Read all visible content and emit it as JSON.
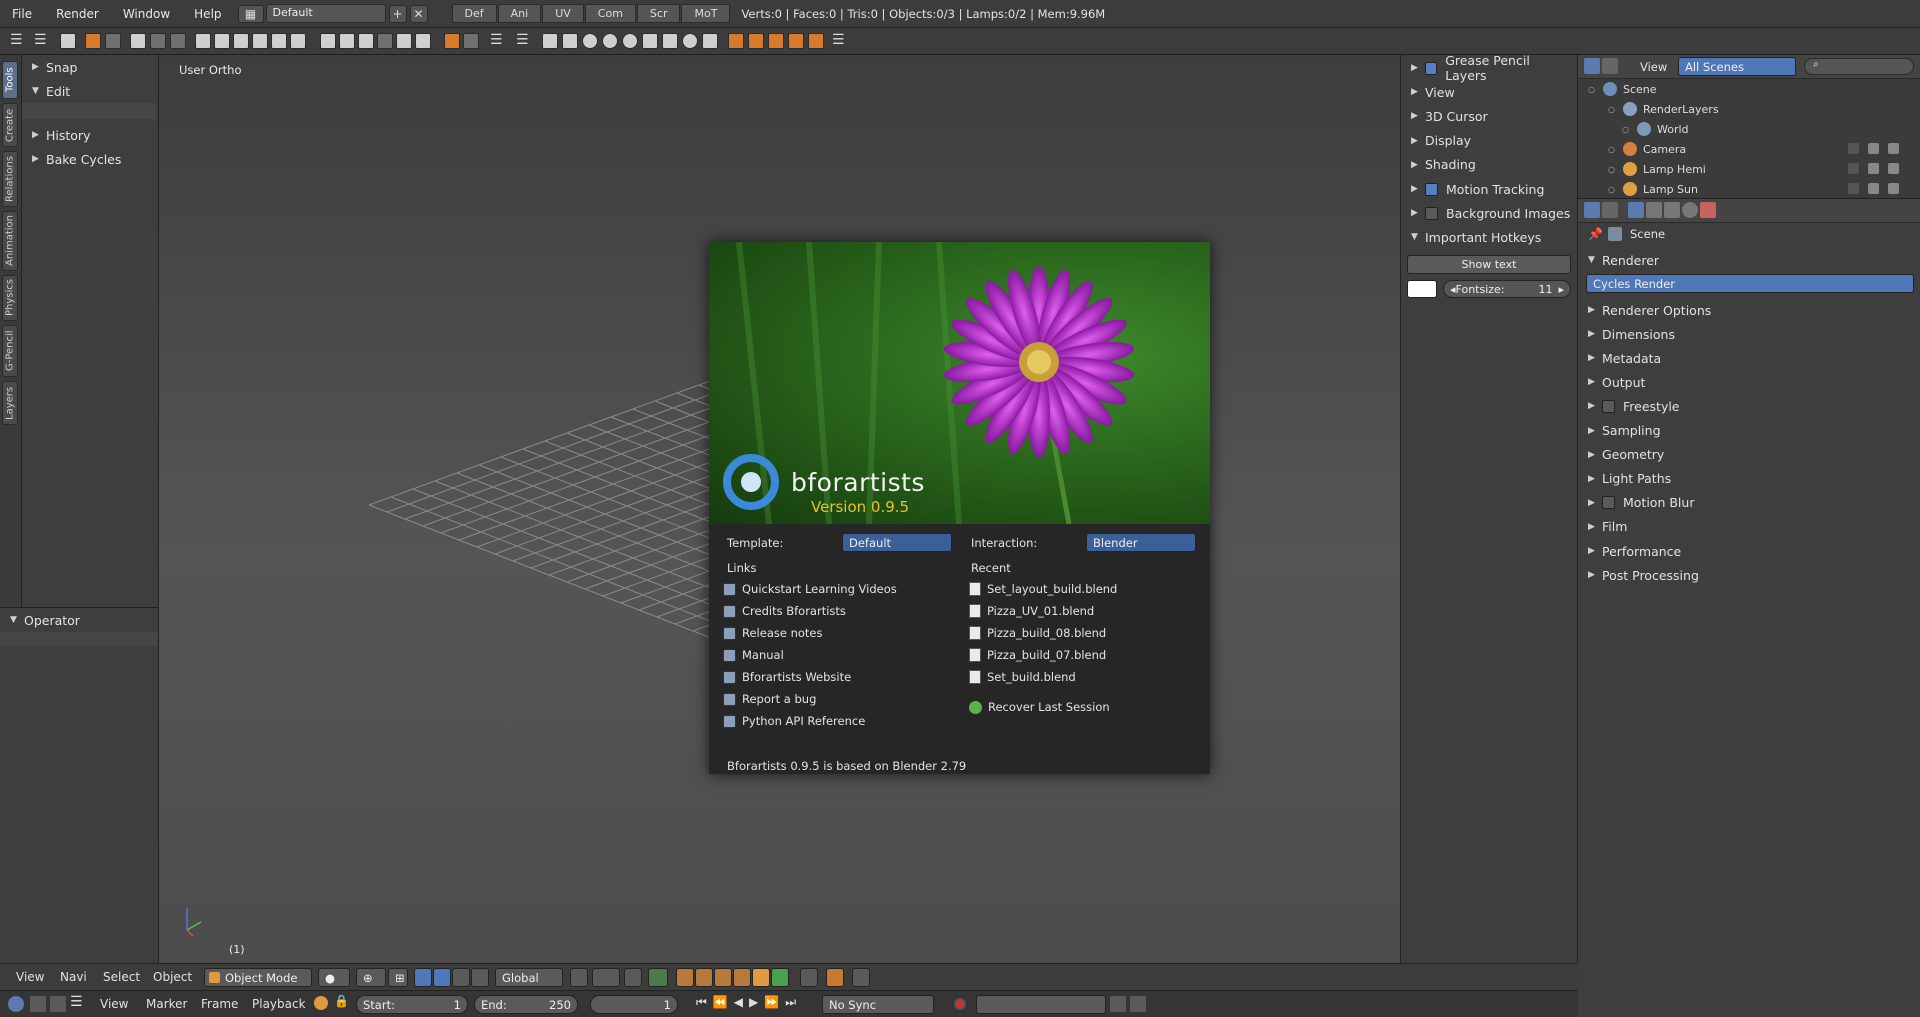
{
  "topbar": {
    "menus": [
      "File",
      "Render",
      "Window",
      "Help"
    ],
    "layout": "Default",
    "workspaces": [
      "Def",
      "Ani",
      "UV",
      "Com",
      "Scr",
      "MoT"
    ],
    "stats": "Verts:0 | Faces:0 | Tris:0 | Objects:0/3 | Lamps:0/2 | Mem:9.96M"
  },
  "vtabs": [
    "Tools",
    "Create",
    "Relations",
    "Animation",
    "Physics",
    "G-Pencil",
    "Layers"
  ],
  "toolshelf": {
    "panels": [
      "Snap",
      "Edit",
      "History",
      "Bake Cycles"
    ],
    "operator": "Operator"
  },
  "viewport": {
    "label": "User Ortho",
    "frame": "(1)"
  },
  "npanel": {
    "items": [
      {
        "label": "Grease Pencil Layers",
        "checkbox": true,
        "checked": true
      },
      {
        "label": "View"
      },
      {
        "label": "3D Cursor"
      },
      {
        "label": "Display"
      },
      {
        "label": "Shading"
      },
      {
        "label": "Motion Tracking",
        "checkbox": true,
        "checked": true
      },
      {
        "label": "Background Images",
        "checkbox": true,
        "checked": false
      },
      {
        "label": "Important Hotkeys",
        "open": true
      }
    ],
    "show_text": "Show text",
    "fontsize_label": "Fontsize:",
    "fontsize_value": "11"
  },
  "outliner": {
    "view": "View",
    "scenes": "All Scenes",
    "rows": [
      "Scene",
      "RenderLayers",
      "World",
      "Camera",
      "Lamp Hemi",
      "Lamp Sun"
    ]
  },
  "properties": {
    "context": "Scene",
    "renderer_header": "Renderer",
    "renderer": "Cycles Render",
    "panels": [
      {
        "label": "Renderer Options"
      },
      {
        "label": "Dimensions"
      },
      {
        "label": "Metadata"
      },
      {
        "label": "Output"
      },
      {
        "label": "Freestyle",
        "checkbox": true
      },
      {
        "label": "Sampling"
      },
      {
        "label": "Geometry"
      },
      {
        "label": "Light Paths"
      },
      {
        "label": "Motion Blur",
        "checkbox": true
      },
      {
        "label": "Film"
      },
      {
        "label": "Performance"
      },
      {
        "label": "Post Processing"
      }
    ]
  },
  "bottom3d": {
    "menus": [
      "View",
      "Navi",
      "Select",
      "Object"
    ],
    "mode": "Object Mode",
    "orientation": "Global"
  },
  "timeline": {
    "menus": [
      "View",
      "Marker",
      "Frame",
      "Playback"
    ],
    "start_label": "Start:",
    "start": "1",
    "end_label": "End:",
    "end": "250",
    "current": "1",
    "sync": "No Sync"
  },
  "splash": {
    "brand": "bforartists",
    "version": "Version 0.9.5",
    "template_label": "Template:",
    "template": "Default",
    "interaction_label": "Interaction:",
    "interaction": "Blender",
    "links_header": "Links",
    "links": [
      "Quickstart Learning Videos",
      "Credits Bforartists",
      "Release notes",
      "Manual",
      "Bforartists Website",
      "Report a bug",
      "Python API Reference"
    ],
    "recent_header": "Recent",
    "recent": [
      "Set_layout_build.blend",
      "Pizza_UV_01.blend",
      "Pizza_build_08.blend",
      "Pizza_build_07.blend",
      "Set_build.blend"
    ],
    "recover": "Recover Last Session",
    "footer": "Bforartists 0.9.5 is based on Blender 2.79"
  }
}
